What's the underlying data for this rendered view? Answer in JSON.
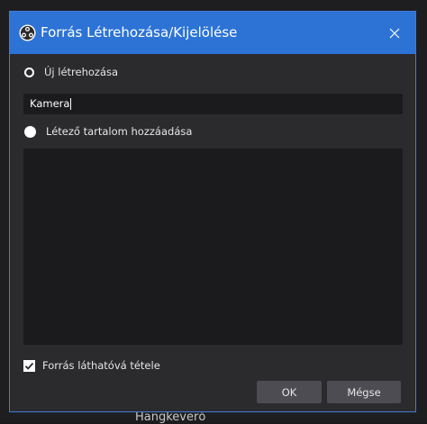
{
  "background": {
    "partial_text": "Hangkeverő"
  },
  "dialog": {
    "title": "Forrás Létrehozása/Kijelölése",
    "close_icon": "close-icon",
    "app_icon": "obs-logo-icon",
    "create_new_label": "Új létrehozása",
    "create_new_selected": false,
    "name_input_value": "Kamera",
    "add_existing_label": "Létező tartalom hozzáadása",
    "add_existing_selected": true,
    "existing_sources": [],
    "make_visible_label": "Forrás láthatóvá tétele",
    "make_visible_checked": true,
    "ok_label": "OK",
    "cancel_label": "Mégse"
  },
  "colors": {
    "titlebar": "#2d73d6",
    "dialog_bg": "#2b2b2e",
    "field_bg": "#1b1b1d",
    "button_bg": "#4c4c52"
  }
}
